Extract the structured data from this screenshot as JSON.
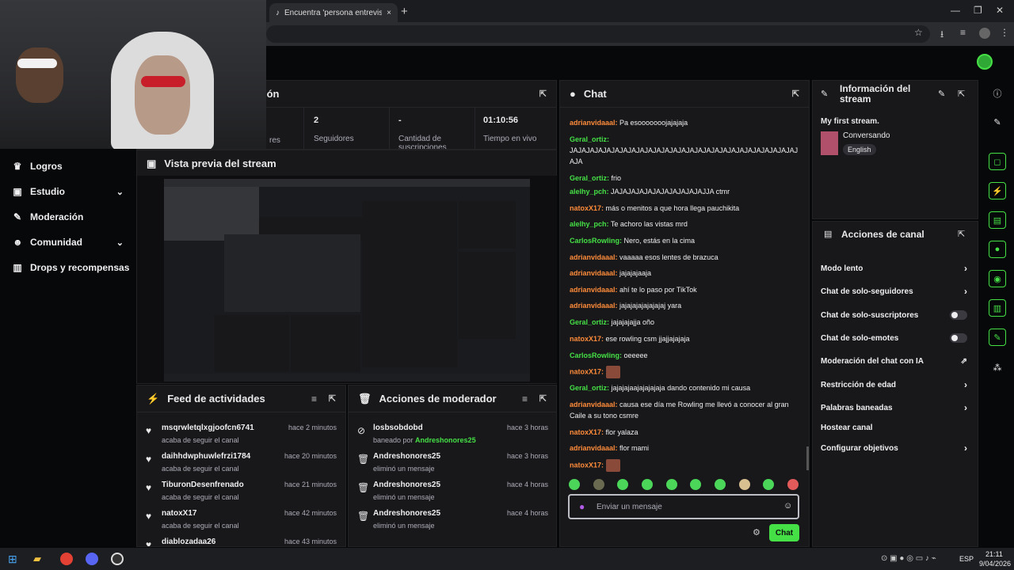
{
  "browser": {
    "tab_title": "Encuentra 'persona entrevista c",
    "tab_close": "×",
    "new_tab": "+"
  },
  "stats_panel": {
    "title_fragment": "ión",
    "stats": [
      {
        "value": "",
        "label": "res"
      },
      {
        "value": "2",
        "label": "Seguidores"
      },
      {
        "value": "-",
        "label": "Cantidad de suscripciones"
      },
      {
        "value": "01:10:56",
        "label": "Tiempo en vivo"
      }
    ]
  },
  "sidebar": {
    "items": [
      {
        "label": "Logros",
        "icon": "trophy-icon",
        "chevron": false
      },
      {
        "label": "Estudio",
        "icon": "studio-icon",
        "chevron": true
      },
      {
        "label": "Moderación",
        "icon": "wrench-icon",
        "chevron": false
      },
      {
        "label": "Comunidad",
        "icon": "people-icon",
        "chevron": true
      },
      {
        "label": "Drops y recompensas",
        "icon": "gift-icon",
        "chevron": false
      }
    ]
  },
  "preview": {
    "title": "Vista previa del stream"
  },
  "feed": {
    "title": "Feed de actividades",
    "items": [
      {
        "name": "msqrwletqlxgjoofcn6741",
        "action": "acaba de seguir el canal",
        "time": "hace 2 minutos"
      },
      {
        "name": "daihhdwphuwlefrzi1784",
        "action": "acaba de seguir el canal",
        "time": "hace 20 minutos"
      },
      {
        "name": "TiburonDesenfrenado",
        "action": "acaba de seguir el canal",
        "time": "hace 21 minutos"
      },
      {
        "name": "natoxX17",
        "action": "acaba de seguir el canal",
        "time": "hace 42 minutos"
      },
      {
        "name": "diablozadaa26",
        "action": "",
        "time": "hace 43 minutos"
      }
    ]
  },
  "modactions": {
    "title": "Acciones de moderador",
    "items": [
      {
        "name": "losbsobdobd",
        "action_prefix": "baneado por ",
        "action_user": "Andreshonores25",
        "time": "hace 3 horas",
        "icon": "ban-icon"
      },
      {
        "name": "Andreshonores25",
        "action_prefix": "eliminó un mensaje",
        "action_user": "",
        "time": "hace 3 horas",
        "icon": "trash-icon"
      },
      {
        "name": "Andreshonores25",
        "action_prefix": "eliminó un mensaje",
        "action_user": "",
        "time": "hace 4 horas",
        "icon": "trash-icon"
      },
      {
        "name": "Andreshonores25",
        "action_prefix": "eliminó un mensaje",
        "action_user": "",
        "time": "hace 4 horas",
        "icon": "trash-icon"
      }
    ]
  },
  "chat": {
    "title": "Chat",
    "messages": [
      {
        "user": "adrianvidaaal",
        "color": "#ff8c3a",
        "text": "Pa esooooooojajajaja"
      },
      {
        "user": "Geral_ortiz",
        "color": "#45e045",
        "text": "JAJAJAJAJAJAJAJAJAJAJAJAJAJAJAJAJAJAJAJAJAJAJAJAJAJAJAJAJA"
      },
      {
        "user": "Geral_ortiz",
        "color": "#45e045",
        "text": "frio"
      },
      {
        "user": "alelhy_pch",
        "color": "#45e045",
        "text": "JAJAJAJAJAJAJAJAJAJAJAJJA ctmr"
      },
      {
        "user": "natoxX17",
        "color": "#ff8c3a",
        "text": "más o menitos a que hora llega pauchikita"
      },
      {
        "user": "alelhy_pch",
        "color": "#45e045",
        "text": "Te achoro las vistas mrd"
      },
      {
        "user": "CarlosRowling",
        "color": "#45e045",
        "text": "Nero, estás en la cima"
      },
      {
        "user": "adrianvidaaal",
        "color": "#ff8c3a",
        "text": "vaaaaa esos lentes de brazuca"
      },
      {
        "user": "adrianvidaaal",
        "color": "#ff8c3a",
        "text": "jajajajaaja"
      },
      {
        "user": "adrianvidaaal",
        "color": "#ff8c3a",
        "text": "ahí te lo paso por TikTok"
      },
      {
        "user": "adrianvidaaal",
        "color": "#ff8c3a",
        "text": "jajajajajajajajaj yara"
      },
      {
        "user": "Geral_ortiz",
        "color": "#45e045",
        "text": "jajajajajja oño"
      },
      {
        "user": "natoxX17",
        "color": "#ff8c3a",
        "text": "ese rowling csm jjajjajajaja"
      },
      {
        "user": "CarlosRowling",
        "color": "#45e045",
        "text": "oeeeee"
      },
      {
        "user": "natoxX17",
        "color": "#ff8c3a",
        "text": ""
      },
      {
        "user": "Geral_ortiz",
        "color": "#45e045",
        "text": "jajajajaajajajajaja dando contenido mi causa"
      },
      {
        "user": "adrianvidaaal",
        "color": "#ff8c3a",
        "text": "causa ese día me Rowling me llevó a conocer al gran Caile a su tono csmre"
      },
      {
        "user": "natoxX17",
        "color": "#ff8c3a",
        "text": "flor yalaza"
      },
      {
        "user": "adrianvidaaal",
        "color": "#ff8c3a",
        "text": "flor mami"
      },
      {
        "user": "natoxX17",
        "color": "#ff8c3a",
        "text": ""
      }
    ],
    "input_placeholder": "Enviar un mensaje",
    "send_label": "Chat"
  },
  "info": {
    "title": "Información del stream",
    "stream_title": "My first stream.",
    "category": "Conversando",
    "language": "English"
  },
  "channel_actions": {
    "title": "Acciones de canal",
    "items": [
      {
        "label": "Modo lento",
        "control": "chevron"
      },
      {
        "label": "Chat de solo-seguidores",
        "control": "chevron"
      },
      {
        "label": "Chat de solo-suscriptores",
        "control": "toggle"
      },
      {
        "label": "Chat de solo-emotes",
        "control": "toggle"
      },
      {
        "label": "Moderación del chat con IA",
        "control": "external"
      },
      {
        "label": "Restricción de edad",
        "control": "chevron"
      },
      {
        "label": "Palabras baneadas",
        "control": "chevron"
      },
      {
        "label": "Hostear canal",
        "control": "none"
      },
      {
        "label": "Configurar objetivos",
        "control": "chevron"
      }
    ]
  },
  "taskbar": {
    "lang": "ESP",
    "time": "21:11",
    "date": "9/04/2026"
  },
  "colors": {
    "accent": "#45e045",
    "orange": "#ff8c3a",
    "panel": "#18181b"
  }
}
